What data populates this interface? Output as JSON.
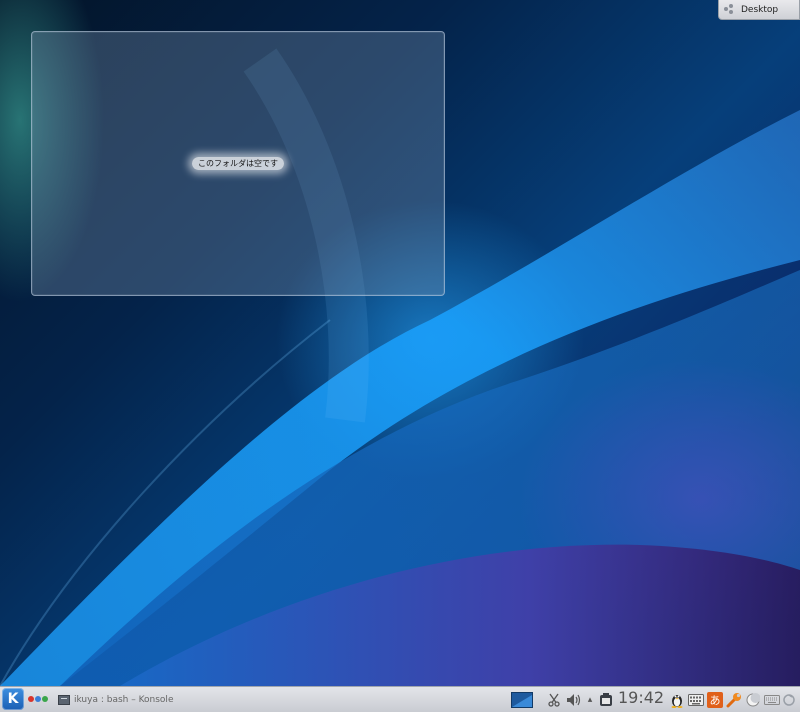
{
  "desktop": {
    "toolbox_label": "Desktop"
  },
  "folder_view": {
    "empty_message": "このフォルダは空です"
  },
  "taskbar": {
    "launcher_glyph": "K",
    "task_label": "ikuya : bash – Konsole"
  },
  "tray": {
    "clock": "19:42",
    "expand_glyph": "▴",
    "ime_glyph": "あ"
  },
  "colors": {
    "kicker": "#1b5fb4",
    "pager_dots": [
      "#d9342b",
      "#3a7ed8",
      "#3aa64a"
    ]
  }
}
